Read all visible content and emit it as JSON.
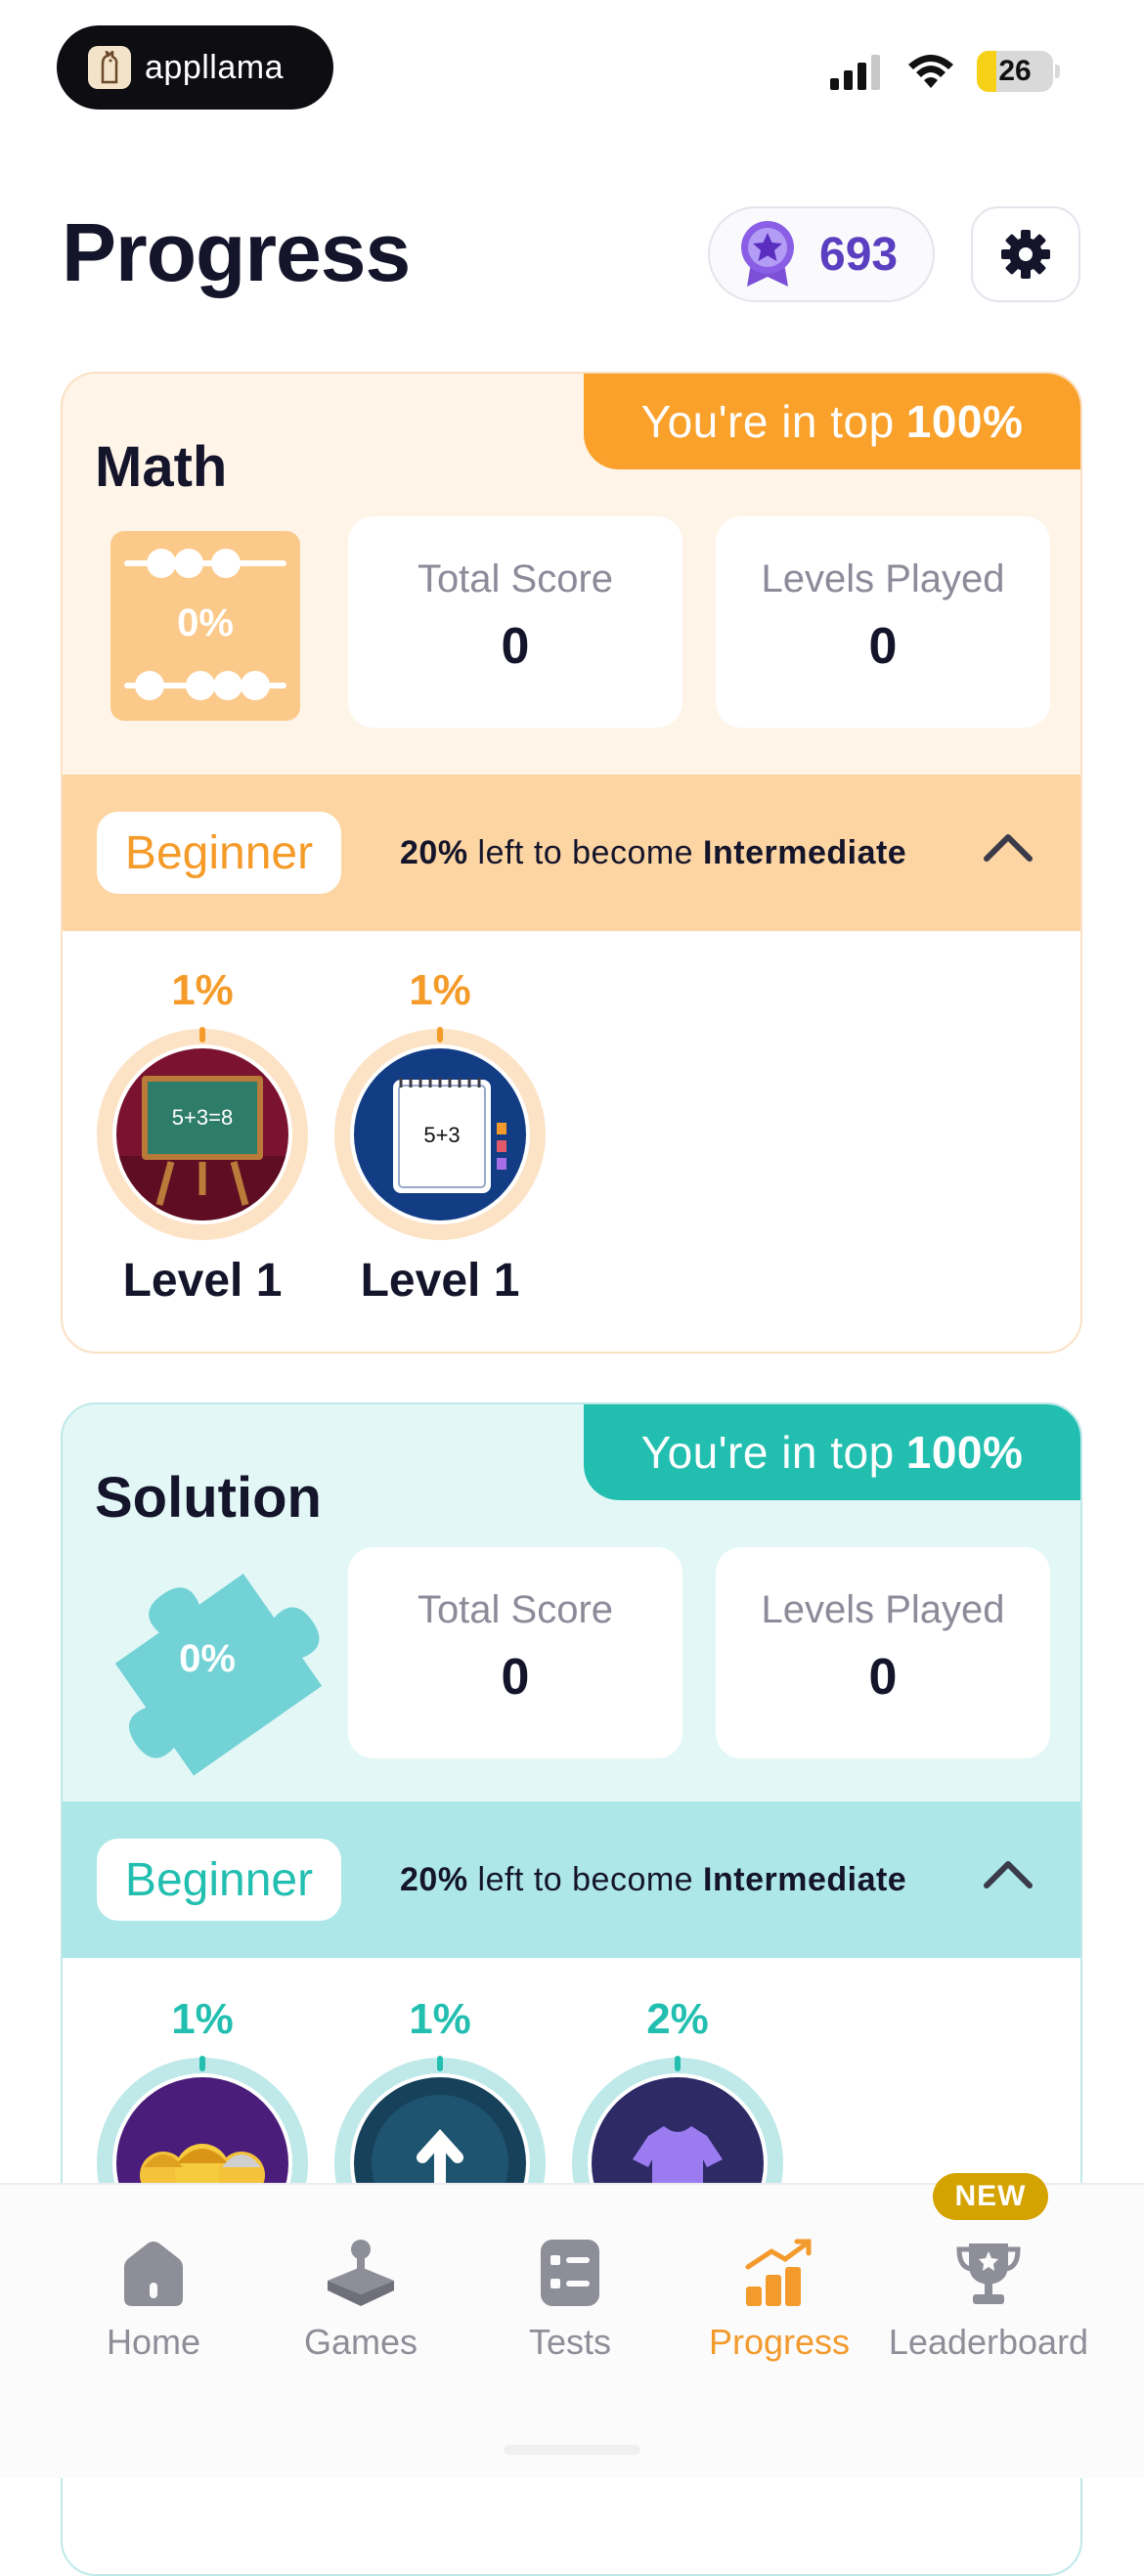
{
  "status_bar": {
    "app_name": "appllama",
    "battery": "26"
  },
  "header": {
    "title": "Progress",
    "points": "693"
  },
  "math": {
    "title": "Math",
    "rank_prefix": "You're in top",
    "rank_value": "100%",
    "completion": "0%",
    "total_score_label": "Total Score",
    "total_score": "0",
    "levels_played_label": "Levels Played",
    "levels_played": "0",
    "level": "Beginner",
    "progress_pct": "20%",
    "progress_mid": "left to become",
    "next_level": "Intermediate",
    "games": [
      {
        "pct": "1%",
        "level": "Level 1",
        "chalk_text": "5+3=8"
      },
      {
        "pct": "1%",
        "level": "Level 1",
        "note_text": "5+3"
      }
    ]
  },
  "solution": {
    "title": "Solution",
    "rank_prefix": "You're in top",
    "rank_value": "100%",
    "completion": "0%",
    "total_score_label": "Total Score",
    "total_score": "0",
    "levels_played_label": "Levels Played",
    "levels_played": "0",
    "level": "Beginner",
    "progress_pct": "20%",
    "progress_mid": "left to become",
    "next_level": "Intermediate",
    "games": [
      {
        "pct": "1%"
      },
      {
        "pct": "1%"
      },
      {
        "pct": "2%"
      }
    ]
  },
  "tab_bar": {
    "tabs": [
      {
        "label": "Home",
        "icon": "home-icon"
      },
      {
        "label": "Games",
        "icon": "joystick-icon"
      },
      {
        "label": "Tests",
        "icon": "tests-icon"
      },
      {
        "label": "Progress",
        "icon": "chart-icon",
        "active": true
      },
      {
        "label": "Leaderboard",
        "icon": "trophy-icon"
      }
    ],
    "new_badge": "NEW"
  },
  "colors": {
    "math_accent": "#f9a12a",
    "solution_accent": "#22bfb0",
    "points": "#5a3fc0",
    "active_tab": "#f39a2c"
  }
}
